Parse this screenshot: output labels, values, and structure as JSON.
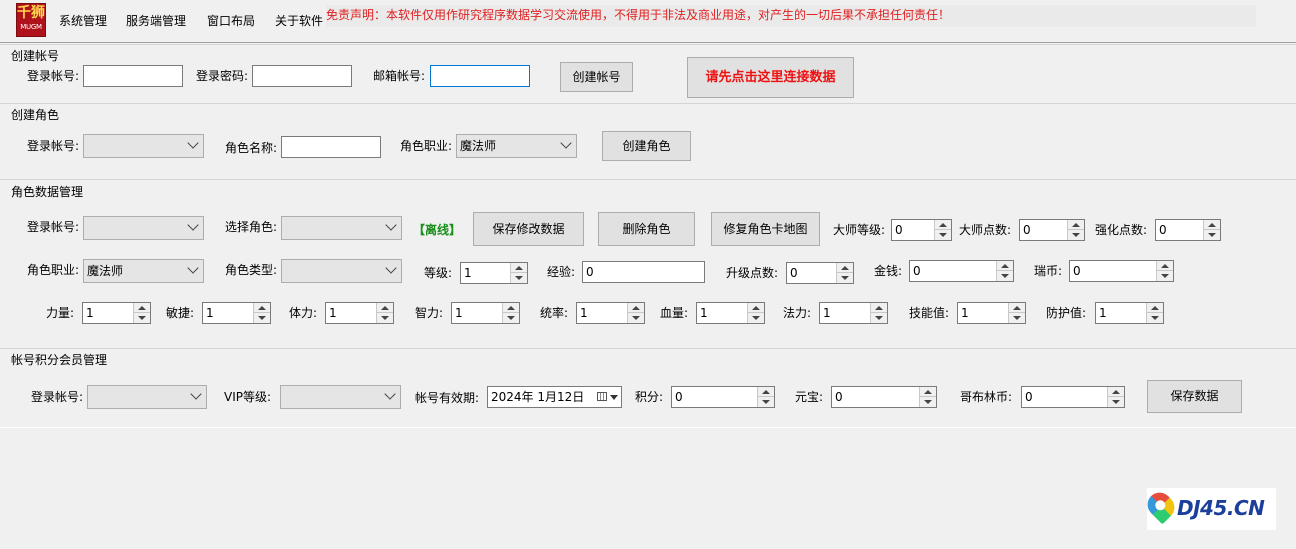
{
  "logo": {
    "big": "千狮",
    "small": "MUGM"
  },
  "menu": [
    "系统管理",
    "服务端管理",
    "窗口布局",
    "关于软件"
  ],
  "disclaimer": "免责声明：本软件仅用作研究程序数据学习交流使用，不得用于非法及商业用途，对产生的一切后果不承担任何责任！",
  "create_account": {
    "title": "创建帐号",
    "login_label": "登录帐号:",
    "login_value": "",
    "password_label": "登录密码:",
    "password_value": "",
    "email_label": "邮箱帐号:",
    "email_value": "",
    "create_button": "创建帐号",
    "connect_button": "请先点击这里连接数据"
  },
  "create_role": {
    "title": "创建角色",
    "login_label": "登录帐号:",
    "login_value": "",
    "role_name_label": "角色名称:",
    "role_name_value": "",
    "job_label": "角色职业:",
    "job_value": "魔法师",
    "create_button": "创建角色"
  },
  "role_data": {
    "title": "角色数据管理",
    "login_label": "登录帐号:",
    "login_value": "",
    "select_role_label": "选择角色:",
    "select_role_value": "",
    "status": "【离线】",
    "save_button": "保存修改数据",
    "delete_button": "删除角色",
    "fix_button": "修复角色卡地图",
    "master_level_label": "大师等级:",
    "master_level_value": "0",
    "master_points_label": "大师点数:",
    "master_points_value": "0",
    "enhance_points_label": "强化点数:",
    "enhance_points_value": "0",
    "job_label": "角色职业:",
    "job_value": "魔法师",
    "role_type_label": "角色类型:",
    "role_type_value": "",
    "level_label": "等级:",
    "level_value": "1",
    "exp_label": "经验:",
    "exp_value": "0",
    "upgrade_points_label": "升级点数:",
    "upgrade_points_value": "0",
    "money_label": "金钱:",
    "money_value": "0",
    "ruby_label": "瑞币:",
    "ruby_value": "0",
    "stats": [
      {
        "label": "力量:",
        "value": "1"
      },
      {
        "label": "敏捷:",
        "value": "1"
      },
      {
        "label": "体力:",
        "value": "1"
      },
      {
        "label": "智力:",
        "value": "1"
      },
      {
        "label": "统率:",
        "value": "1"
      },
      {
        "label": "血量:",
        "value": "1"
      },
      {
        "label": "法力:",
        "value": "1"
      },
      {
        "label": "技能值:",
        "value": "1"
      },
      {
        "label": "防护值:",
        "value": "1"
      }
    ]
  },
  "vip": {
    "title": "帐号积分会员管理",
    "login_label": "登录帐号:",
    "login_value": "",
    "vip_label": "VIP等级:",
    "vip_value": "",
    "expiry_label": "帐号有效期:",
    "expiry_value": "2024年  1月12日",
    "points_label": "积分:",
    "points_value": "0",
    "yuanbao_label": "元宝:",
    "yuanbao_value": "0",
    "goblin_label": "哥布林币:",
    "goblin_value": "0",
    "save_button": "保存数据"
  },
  "watermark": "DJ45.CN"
}
